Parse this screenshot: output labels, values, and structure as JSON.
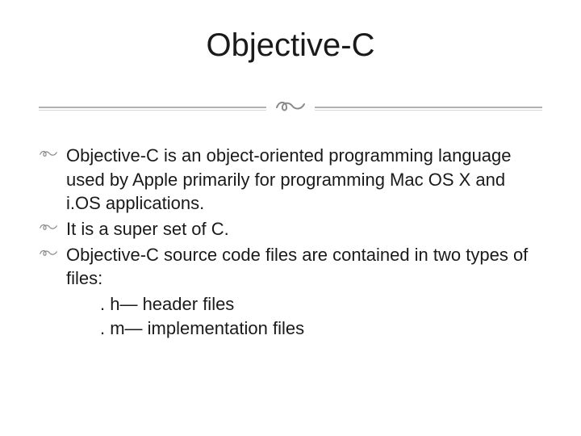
{
  "title": "Objective-C",
  "flourish_glyph": "\u0018",
  "bullets": [
    {
      "text": "Objective-C is an object-oriented programming language used by Apple primarily for programming Mac OS X and i.OS applications."
    },
    {
      "text": "It is a super set of C."
    },
    {
      "text": "Objective-C source code files are contained in two types of files:"
    }
  ],
  "sublines": [
    ". h— header files",
    ". m— implementation files"
  ]
}
